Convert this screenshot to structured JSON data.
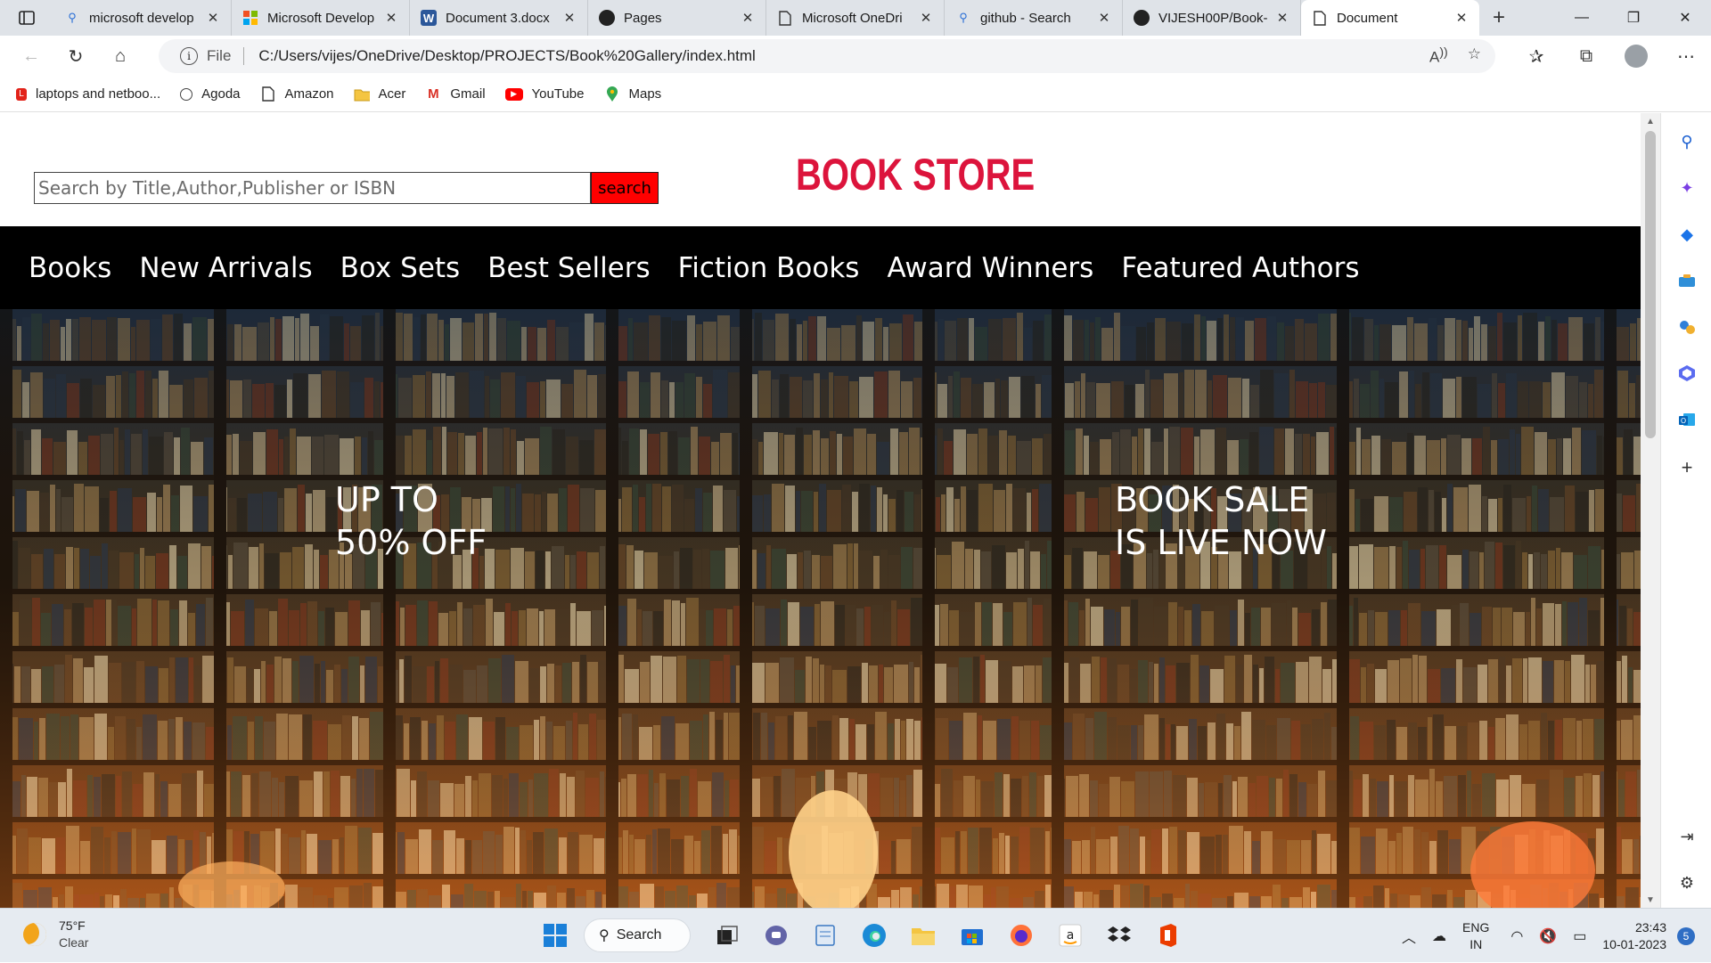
{
  "browser": {
    "tabs": [
      {
        "title": "microsoft develop",
        "icon": "bing-search-icon"
      },
      {
        "title": "Microsoft Develop",
        "icon": "microsoft-logo-icon"
      },
      {
        "title": "Document 3.docx",
        "icon": "word-icon"
      },
      {
        "title": "Pages",
        "icon": "github-icon"
      },
      {
        "title": "Microsoft OneDri",
        "icon": "page-icon"
      },
      {
        "title": "github - Search",
        "icon": "bing-search-icon"
      },
      {
        "title": "VIJESH00P/Book-",
        "icon": "github-icon"
      },
      {
        "title": "Document",
        "icon": "page-icon",
        "active": true
      }
    ],
    "address": {
      "scheme": "File",
      "url": "C:/Users/vijes/OneDrive/Desktop/PROJECTS/Book%20Gallery/index.html"
    },
    "bookmarks": [
      {
        "label": "laptops and netboo...",
        "icon": "lenovo-icon"
      },
      {
        "label": "Agoda",
        "icon": "agoda-icon"
      },
      {
        "label": "Amazon",
        "icon": "page-icon"
      },
      {
        "label": "Acer",
        "icon": "folder-icon"
      },
      {
        "label": "Gmail",
        "icon": "gmail-icon"
      },
      {
        "label": "YouTube",
        "icon": "youtube-icon"
      },
      {
        "label": "Maps",
        "icon": "maps-icon"
      }
    ]
  },
  "page": {
    "search_placeholder": "Search by Title,Author,Publisher or ISBN",
    "search_button": "search",
    "store_title": "BOOK STORE",
    "nav": [
      "Books",
      "New Arrivals",
      "Box Sets",
      "Best Sellers",
      "Fiction Books",
      "Award Winners",
      "Featured Authors"
    ],
    "hero": {
      "left_line1": "UP TO",
      "left_line2": "50% OFF",
      "right_line1": "BOOK SALE",
      "right_line2": "IS LIVE NOW"
    },
    "colors": {
      "title": "#dc143c",
      "search_button": "#ff0000",
      "navbar": "#000000"
    }
  },
  "taskbar": {
    "weather_temp": "75°F",
    "weather_desc": "Clear",
    "search_label": "Search",
    "lang_line1": "ENG",
    "lang_line2": "IN",
    "time": "23:43",
    "date": "10-01-2023",
    "notification_count": "5"
  }
}
